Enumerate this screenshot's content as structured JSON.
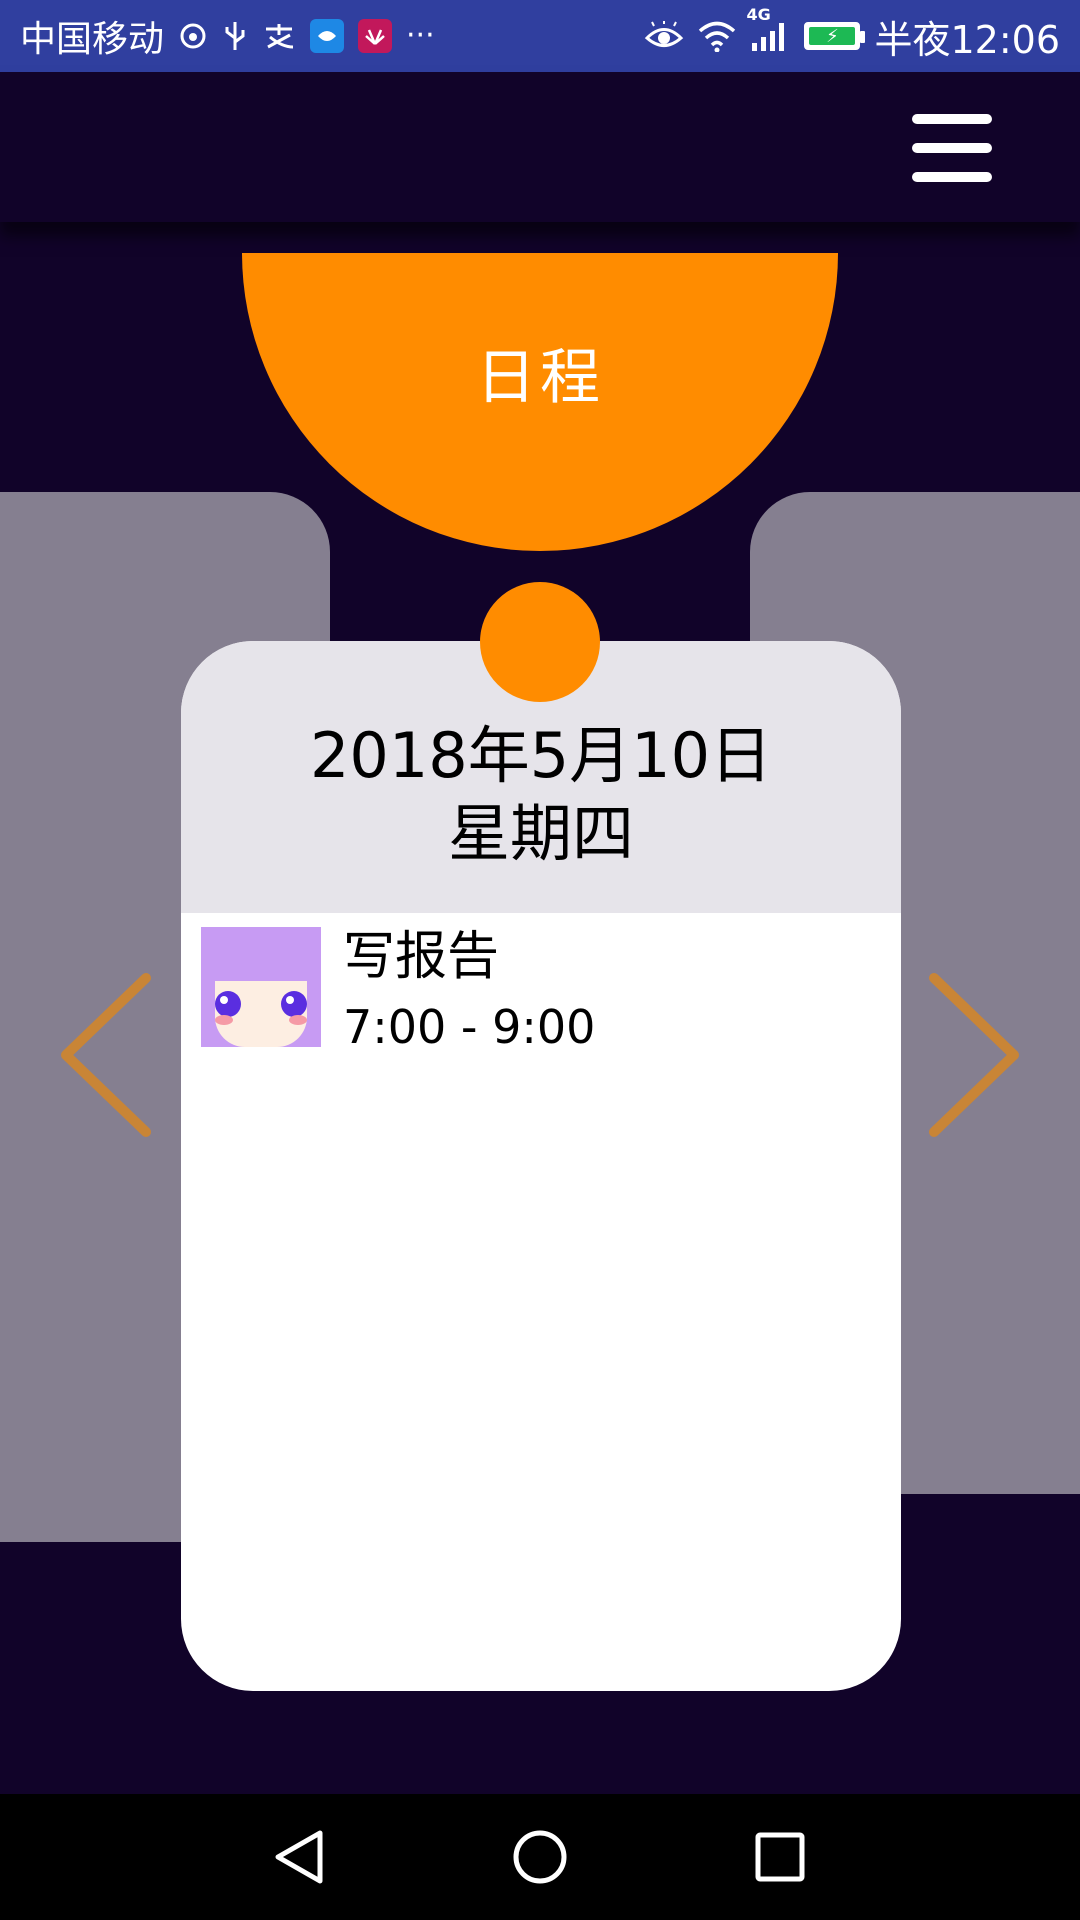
{
  "status_bar": {
    "carrier": "中国移动",
    "icons": [
      "netease-music-icon",
      "usb-icon",
      "alipay-icon",
      "tencent-app-icon",
      "huawei-app-icon",
      "more-icon"
    ],
    "more": "···",
    "network": "4G",
    "time": "半夜12:06"
  },
  "app_bar": {
    "menu_icon": "hamburger-menu-icon"
  },
  "header": {
    "title": "日程"
  },
  "card": {
    "date": "2018年5月10日",
    "weekday": "星期四",
    "events": [
      {
        "title": "写报告",
        "time": "7:00 - 9:00"
      }
    ]
  },
  "navigation": {
    "prev_icon": "chevron-left-icon",
    "next_icon": "chevron-right-icon"
  },
  "system_nav": {
    "back_icon": "back-triangle-icon",
    "home_icon": "home-circle-icon",
    "recents_icon": "recents-square-icon"
  },
  "colors": {
    "background": "#110329",
    "accent": "#ff8c00",
    "side_card": "#857f90",
    "card_header": "#e6e4ea",
    "arrow": "#c98536",
    "status_bar": "#303f9f"
  }
}
